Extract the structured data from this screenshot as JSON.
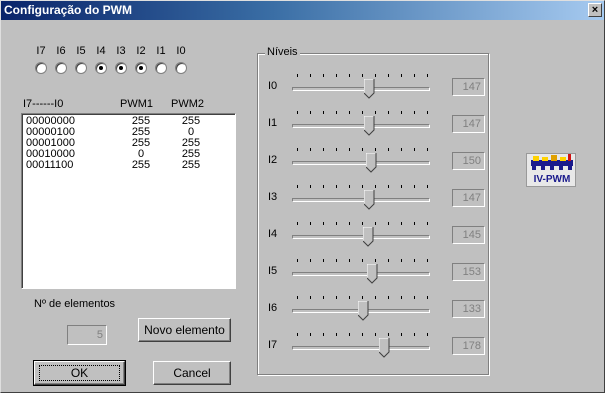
{
  "window": {
    "title": "Configuração do PWM",
    "close_label": "×"
  },
  "bits": {
    "labels": [
      "I7",
      "I6",
      "I5",
      "I4",
      "I3",
      "I2",
      "I1",
      "I0"
    ],
    "selected": [
      false,
      false,
      false,
      true,
      true,
      true,
      false,
      false
    ]
  },
  "table": {
    "headers": [
      "I7------I0",
      "PWM1",
      "PWM2"
    ],
    "rows": [
      [
        "00000000",
        "255",
        "255"
      ],
      [
        "00000100",
        "255",
        "0"
      ],
      [
        "00001000",
        "255",
        "255"
      ],
      [
        "00010000",
        "0",
        "255"
      ],
      [
        "00011100",
        "255",
        "255"
      ]
    ]
  },
  "elements": {
    "label": "Nº de elementos",
    "count": "5",
    "new_button": "Novo elemento"
  },
  "buttons": {
    "ok": "OK",
    "cancel": "Cancel"
  },
  "levels": {
    "group_title": "Níveis",
    "max": 255,
    "sliders": [
      {
        "label": "I0",
        "value": "147"
      },
      {
        "label": "I1",
        "value": "147"
      },
      {
        "label": "I2",
        "value": "150"
      },
      {
        "label": "I3",
        "value": "147"
      },
      {
        "label": "I4",
        "value": "145"
      },
      {
        "label": "I5",
        "value": "153"
      },
      {
        "label": "I6",
        "value": "133"
      },
      {
        "label": "I7",
        "value": "178"
      }
    ]
  },
  "logo": {
    "text": "IV-PWM",
    "icon": "iv-pwm-logo-icon"
  }
}
